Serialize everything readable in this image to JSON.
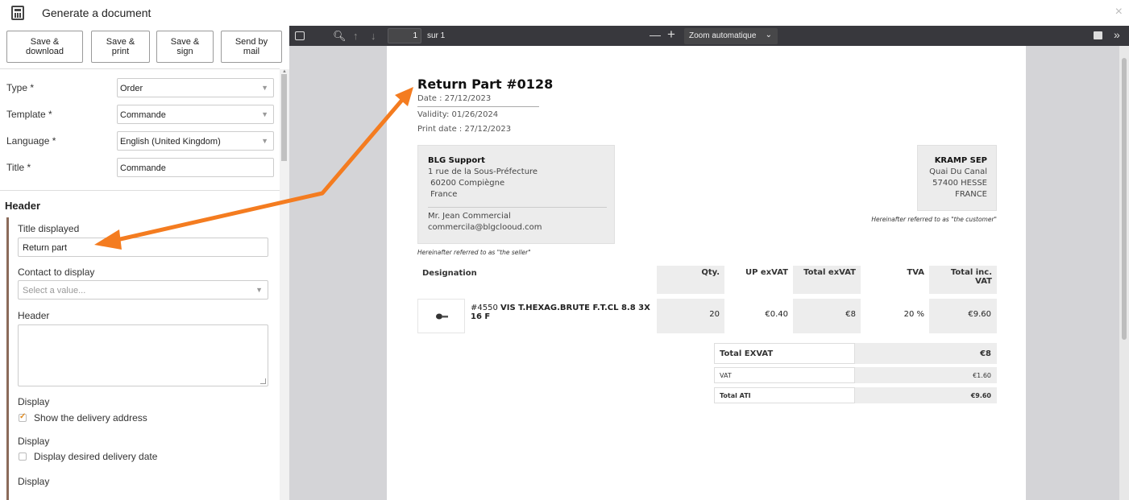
{
  "window": {
    "title": "Generate a document",
    "close_glyph": "×"
  },
  "actions": {
    "save_download": [
      "Save &",
      "download"
    ],
    "save_print": [
      "Save &",
      "print"
    ],
    "save_sign": [
      "Save &",
      "sign"
    ],
    "send_mail": [
      "Send by",
      "mail"
    ]
  },
  "form": {
    "type_label": "Type *",
    "type_value": "Order",
    "template_label": "Template *",
    "template_value": "Commande",
    "language_label": "Language *",
    "language_value": "English (United Kingdom)",
    "title_label": "Title *",
    "title_value": "Commande"
  },
  "header_section": {
    "title": "Header",
    "title_displayed_label": "Title displayed",
    "title_displayed_value": "Return part",
    "contact_label": "Contact to display",
    "contact_placeholder": "Select a value...",
    "header_label": "Header",
    "display1_label": "Display",
    "show_delivery_label": "Show the delivery address",
    "show_delivery_checked": true,
    "display2_label": "Display",
    "desired_date_label": "Display desired delivery date",
    "desired_date_checked": false,
    "display3_label": "Display"
  },
  "viewer": {
    "page_number": "1",
    "page_of": "sur 1",
    "zoom": "Zoom automatique",
    "minus": "—",
    "plus": "+"
  },
  "document": {
    "title": "Return Part #0128",
    "date": "Date : 27/12/2023",
    "validity": "Validity: 01/26/2024",
    "print_date": "Print date : 27/12/2023",
    "seller": {
      "name": "BLG Support",
      "address1": "1 rue de la Sous-Préfecture",
      "address2": " 60200 Compiègne",
      "address3": " France",
      "contact": "Mr. Jean Commercial",
      "email": "commercila@blgclooud.com",
      "note": "Hereinafter referred to as \"the seller\""
    },
    "customer": {
      "name": "KRAMP SEP",
      "address1": "Quai Du Canal",
      "address2": "57400 HESSE",
      "address3": "FRANCE",
      "note": "Hereinafter referred to as \"the customer\""
    },
    "table": {
      "headers": {
        "designation": "Designation",
        "qty": "Qty.",
        "up": "UP exVAT",
        "total_ex": "Total exVAT",
        "tva": "TVA",
        "total_inc": "Total inc. VAT"
      },
      "row": {
        "ref": "#4550",
        "desc": "VIS T.HEXAG.BRUTE F.T.CL 8.8 3X 16 F",
        "qty": "20",
        "up": "€0.40",
        "total_ex": "€8",
        "tva": "20 %",
        "total_inc": "€9.60"
      }
    },
    "totals": {
      "exvat_label": "Total EXVAT",
      "exvat_value": "€8",
      "vat_label": "VAT",
      "vat_value": "€1.60",
      "ati_label": "Total ATI",
      "ati_value": "€9.60"
    }
  },
  "colors": {
    "annotation_arrow": "#f47c20",
    "toolbar": "#38383d",
    "accent": "#e08a1e"
  }
}
